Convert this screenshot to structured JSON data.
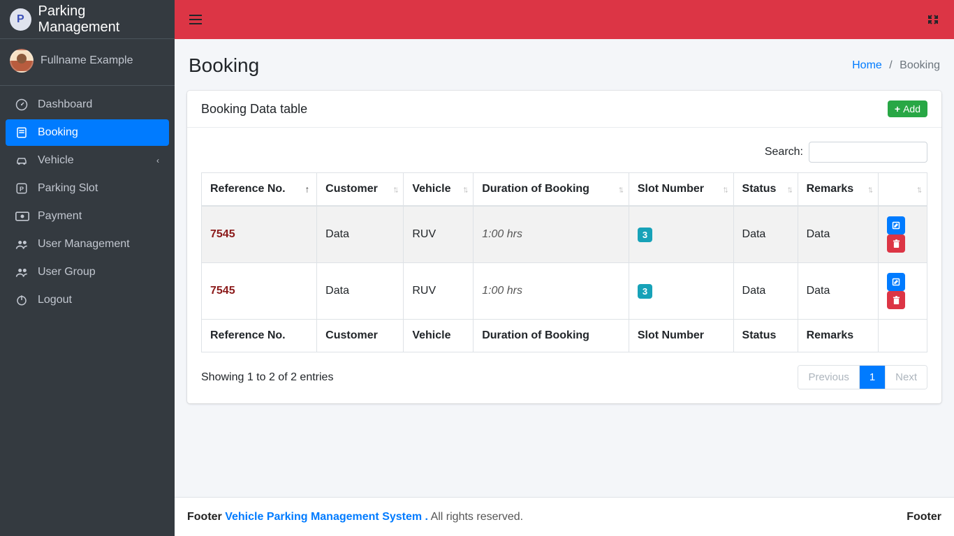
{
  "brand": {
    "title": "Parking Management"
  },
  "user": {
    "fullname": "Fullname Example"
  },
  "sidebar": {
    "items": [
      {
        "label": "Dashboard"
      },
      {
        "label": "Booking"
      },
      {
        "label": "Vehicle"
      },
      {
        "label": "Parking Slot"
      },
      {
        "label": "Payment"
      },
      {
        "label": "User Management"
      },
      {
        "label": "User Group"
      },
      {
        "label": "Logout"
      }
    ]
  },
  "header": {
    "title": "Booking",
    "breadcrumb_home": "Home",
    "breadcrumb_current": "Booking"
  },
  "card": {
    "title": "Booking Data table",
    "add_label": "Add",
    "search_label": "Search:"
  },
  "table": {
    "columns": {
      "ref": "Reference No.",
      "customer": "Customer",
      "vehicle": "Vehicle",
      "duration": "Duration of Booking",
      "slot": "Slot Number",
      "status": "Status",
      "remarks": "Remarks"
    },
    "rows": [
      {
        "ref": "7545",
        "customer": "Data",
        "vehicle": "RUV",
        "duration": "1:00 hrs",
        "slot": "3",
        "status": "Data",
        "remarks": "Data"
      },
      {
        "ref": "7545",
        "customer": "Data",
        "vehicle": "RUV",
        "duration": "1:00 hrs",
        "slot": "3",
        "status": "Data",
        "remarks": "Data"
      }
    ],
    "info": "Showing 1 to 2 of 2 entries"
  },
  "pager": {
    "prev": "Previous",
    "page": "1",
    "next": "Next"
  },
  "footer": {
    "left_prefix": "Footer ",
    "left_link": "Vehicle Parking Management System .",
    "left_suffix": " All rights reserved.",
    "right": "Footer"
  }
}
